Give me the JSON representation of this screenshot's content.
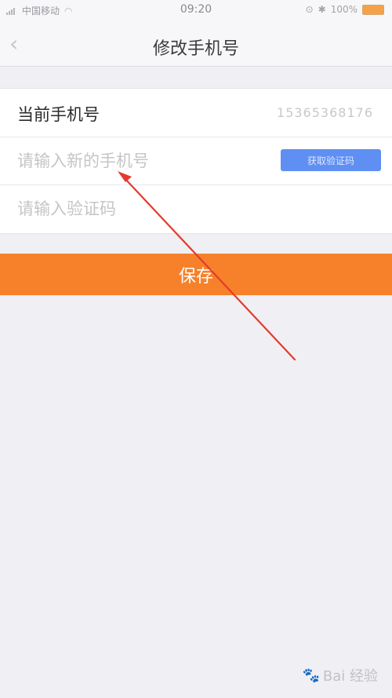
{
  "status_bar": {
    "carrier": "中国移动",
    "time": "09:20",
    "battery_percent": "100%"
  },
  "nav": {
    "title": "修改手机号",
    "back_icon": "chevron-left-icon"
  },
  "form": {
    "current_label": "当前手机号",
    "current_value": "15365368176",
    "new_phone_placeholder": "请输入新的手机号",
    "get_code_label": "获取验证码",
    "code_placeholder": "请输入验证码"
  },
  "save_label": "保存",
  "watermark": "Bai 经验",
  "colors": {
    "accent_orange": "#f6812a",
    "code_button_blue": "#5f8ff2",
    "annotation_red": "#e33b2d"
  }
}
